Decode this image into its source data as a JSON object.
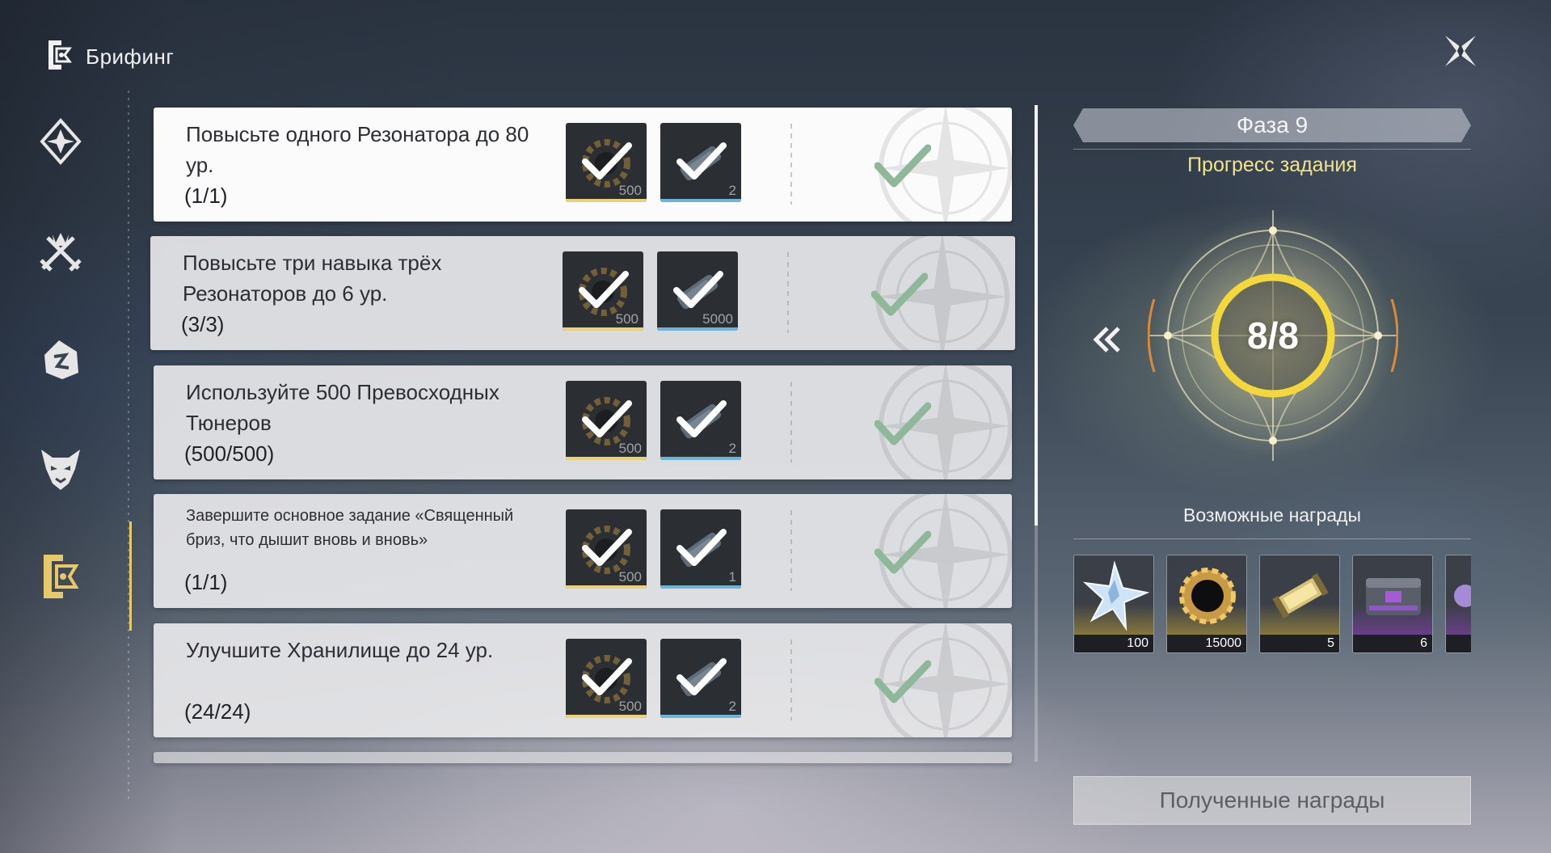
{
  "header": {
    "title": "Брифинг"
  },
  "colors": {
    "accent_yellow": "#e7c96a",
    "ring_yellow": "#f4d83a",
    "check_green": "#8fb89a",
    "strip_gold": "#e9d27a",
    "strip_blue": "#6fb3d6",
    "strip_purple": "#a35bd6"
  },
  "sidebar": {
    "items": [
      {
        "icon": "diamond-emblem-icon",
        "active": false
      },
      {
        "icon": "crossed-swords-icon",
        "active": false
      },
      {
        "icon": "broken-shard-icon",
        "active": false
      },
      {
        "icon": "demon-mask-icon",
        "active": false
      },
      {
        "icon": "briefing-icon",
        "active": true
      }
    ]
  },
  "tasks": [
    {
      "title": "Повысьте одного Резонатора до 80 ур.",
      "progress": "(1/1)",
      "rewards": [
        {
          "qty": "500",
          "strip": "gold"
        },
        {
          "qty": "2",
          "strip": "blue"
        }
      ],
      "completed": true
    },
    {
      "title": "Повысьте три навыка трёх Резонаторов до 6 ур.",
      "progress": "(3/3)",
      "rewards": [
        {
          "qty": "500",
          "strip": "gold"
        },
        {
          "qty": "5000",
          "strip": "blue"
        }
      ],
      "completed": true
    },
    {
      "title": "Используйте 500 Превосходных Тюнеров",
      "progress": "(500/500)",
      "rewards": [
        {
          "qty": "500",
          "strip": "gold"
        },
        {
          "qty": "2",
          "strip": "blue"
        }
      ],
      "completed": true
    },
    {
      "title": "Завершите основное задание «Священный бриз, что дышит вновь и вновь»",
      "progress": "(1/1)",
      "rewards": [
        {
          "qty": "500",
          "strip": "gold"
        },
        {
          "qty": "1",
          "strip": "blue"
        }
      ],
      "completed": true
    },
    {
      "title": "Улучшите Хранилище до 24 ур.",
      "progress": "(24/24)",
      "rewards": [
        {
          "qty": "500",
          "strip": "gold"
        },
        {
          "qty": "2",
          "strip": "blue"
        }
      ],
      "completed": true
    }
  ],
  "panel": {
    "phase": "Фаза 9",
    "progress_label": "Прогресс задания",
    "progress_text": "8/8",
    "progress_done": 8,
    "progress_total": 8,
    "possible_rewards_label": "Возможные награды",
    "rewards": [
      {
        "icon": "astrite-crystal-icon",
        "amount": "100",
        "rarity": "gold"
      },
      {
        "icon": "shell-credit-icon",
        "amount": "15000",
        "rarity": "gold"
      },
      {
        "icon": "premium-tuner-capsule-icon",
        "amount": "5",
        "rarity": "gold"
      },
      {
        "icon": "supply-chest-icon",
        "amount": "6",
        "rarity": "purple"
      },
      {
        "icon": "material-icon",
        "amount": "",
        "rarity": "purple"
      }
    ],
    "claimed_button": "Полученные награды"
  }
}
